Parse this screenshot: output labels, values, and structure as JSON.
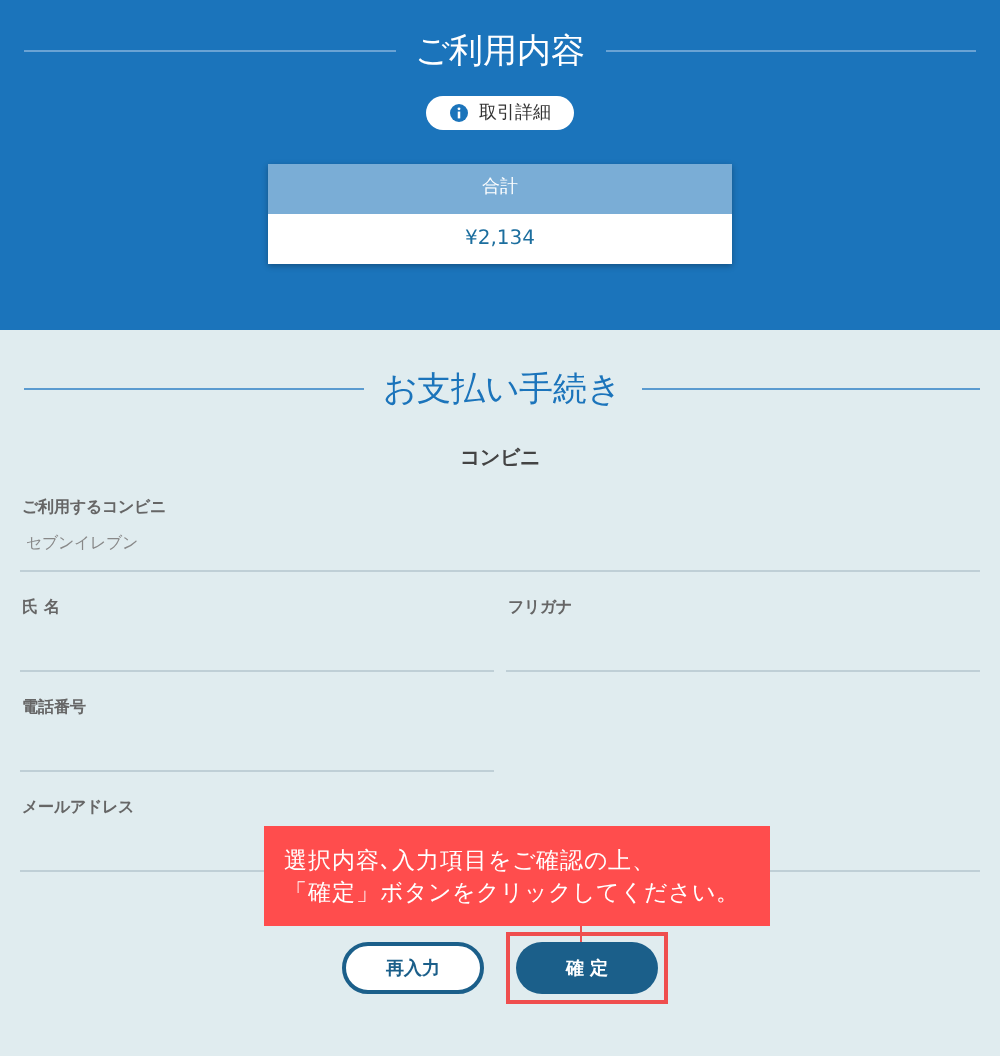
{
  "usage": {
    "title": "ご利用内容",
    "details_button": "取引詳細",
    "total": {
      "label": "合計",
      "value": "¥2,134"
    }
  },
  "payment": {
    "title": "お支払い手続き",
    "method": "コンビニ",
    "rows": [
      {
        "fields": [
          {
            "label": "ご利用するコンビニ",
            "value": "セブンイレブン",
            "kind": "wide"
          }
        ]
      },
      {
        "fields": [
          {
            "label": "氏 名",
            "kind": "half"
          },
          {
            "label": "フリガナ",
            "kind": "half"
          }
        ]
      },
      {
        "fields": [
          {
            "label": "電話番号",
            "kind": "half"
          }
        ]
      },
      {
        "fields": [
          {
            "label": "メールアドレス",
            "kind": "wide"
          }
        ]
      }
    ],
    "buttons": [
      {
        "label": "再入力",
        "kind": "outline"
      },
      {
        "label": "確 定",
        "kind": "primary",
        "highlighted": true
      }
    ]
  },
  "callout": {
    "lines": [
      "選択内容､入力項目をご確認の上、",
      "「確定」ボタンをクリックしてください。"
    ]
  }
}
